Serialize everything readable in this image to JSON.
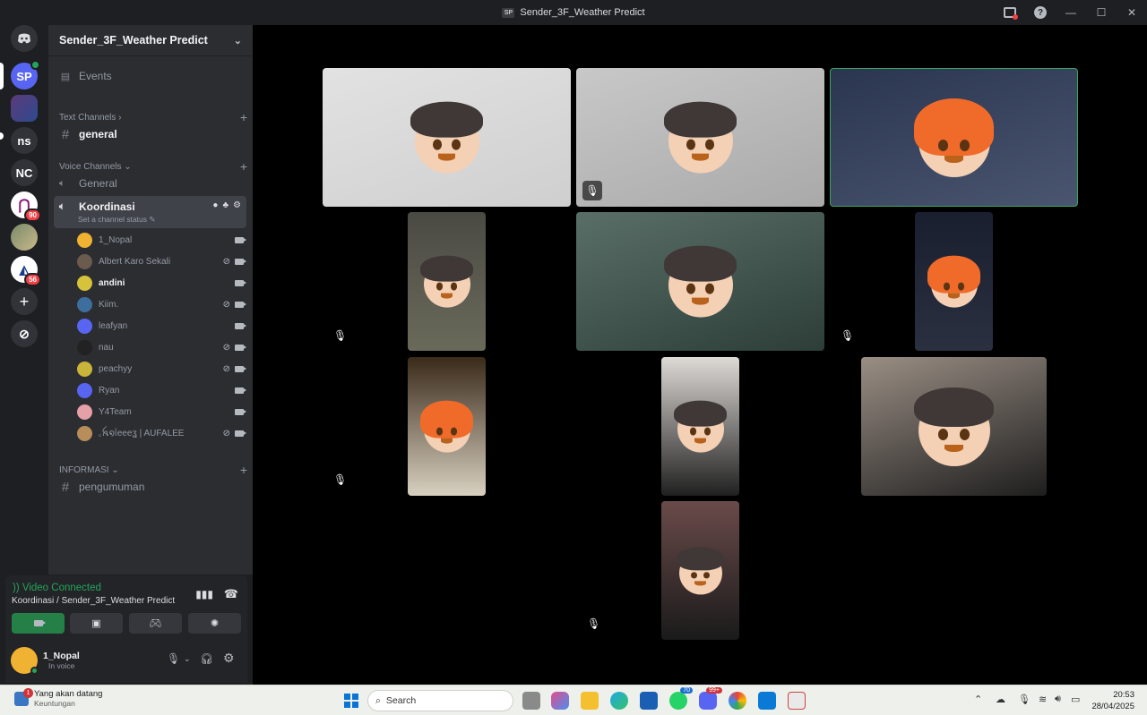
{
  "window": {
    "title": "Sender_3F_Weather Predict",
    "badge": "SP"
  },
  "servers": [
    {
      "label": "",
      "icon": "discord-home-icon"
    },
    {
      "label": "SP",
      "icon": "server-sp"
    },
    {
      "label": "",
      "icon": "server-image"
    },
    {
      "label": "ns",
      "icon": "server-ns"
    },
    {
      "label": "NC",
      "icon": "server-nc"
    },
    {
      "label": "",
      "icon": "server-logo",
      "badge": "90"
    },
    {
      "label": "",
      "icon": "server-photo"
    },
    {
      "label": "",
      "icon": "server-kite",
      "badge": "56"
    },
    {
      "label": "+",
      "icon": "add-server-icon"
    },
    {
      "label": "",
      "icon": "explore-icon"
    }
  ],
  "guild": {
    "name": "Sender_3F_Weather Predict"
  },
  "sidebar": {
    "events": "Events",
    "text_category": "Text Channels",
    "general_text": "general",
    "voice_category": "Voice Channels",
    "general_voice": "General",
    "active_voice": "Koordinasi",
    "active_voice_status": "Set a channel status",
    "info_category": "INFORMASI",
    "announce": "pengumuman"
  },
  "voice_users": [
    {
      "name": "1_Nopal",
      "color": "#f0b232",
      "muted": false
    },
    {
      "name": "Albert Karo Sekali",
      "color": "#6b5a4e",
      "muted": true
    },
    {
      "name": "andini",
      "color": "#d6c23b",
      "muted": false,
      "bold": true
    },
    {
      "name": "Kiim.",
      "color": "#3d6e9e",
      "muted": true
    },
    {
      "name": "leafyan",
      "color": "#5865f2",
      "muted": false
    },
    {
      "name": "nau",
      "color": "#222222",
      "muted": true
    },
    {
      "name": "peachyy",
      "color": "#c9b53a",
      "muted": true
    },
    {
      "name": "Ryan",
      "color": "#5865f2",
      "muted": false
    },
    {
      "name": "Y4Team",
      "color": "#e6a0a8",
      "muted": false
    },
    {
      "name": "꜀ꫝ໑ᥣeeeʓ | AUFALEE",
      "color": "#b98d5a",
      "muted": true
    }
  ],
  "voice_panel": {
    "status": "Video Connected",
    "channel": "Koordinasi / Sender_3F_Weather Predict",
    "user_name": "1_Nopal",
    "user_status": "In voice"
  },
  "taskbar": {
    "weather_title": "Yang akan datang",
    "weather_sub": "Keuntungan",
    "weather_badge": "1",
    "search": "Search",
    "whatsapp_count": "70",
    "discord_count": "99+",
    "time": "20:53",
    "date": "28/04/2025"
  },
  "colors": {
    "accent": "#5865f2",
    "connected": "#23a55a",
    "danger": "#f23f43",
    "sidebar": "#2b2d31"
  }
}
